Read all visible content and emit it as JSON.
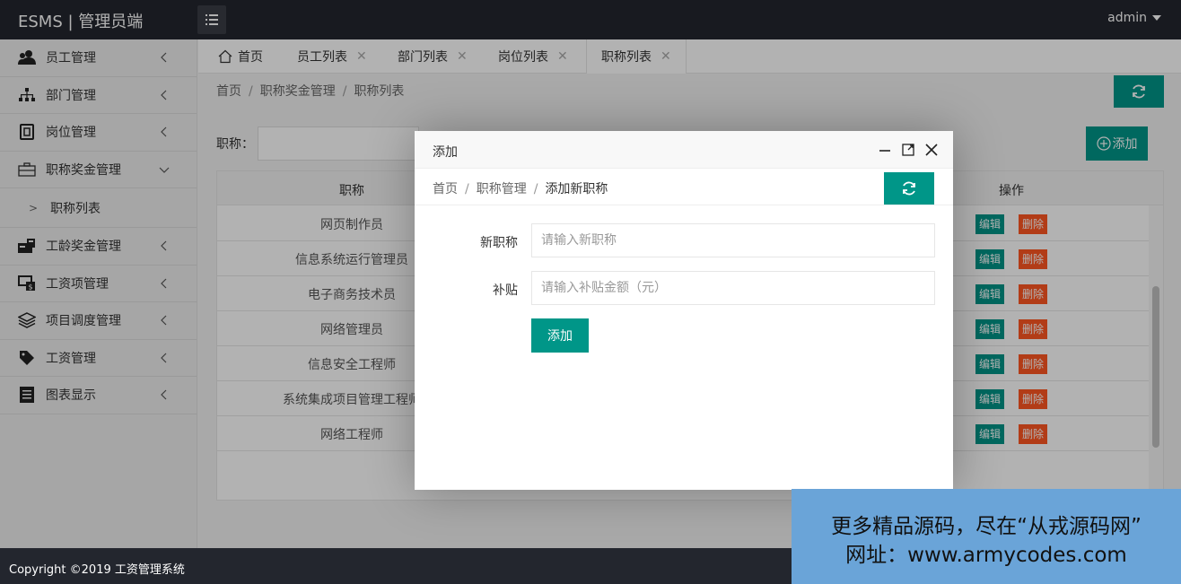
{
  "app": {
    "title": "ESMS | 管理员端",
    "user": "admin"
  },
  "sidebar": {
    "items": [
      {
        "label": "员工管理",
        "icon": "users-icon"
      },
      {
        "label": "部门管理",
        "icon": "sitemap-icon"
      },
      {
        "label": "岗位管理",
        "icon": "id-card-icon"
      },
      {
        "label": "职称奖金管理",
        "icon": "briefcase-icon",
        "expanded": true
      },
      {
        "label": "工龄奖金管理",
        "icon": "wallet-icon"
      },
      {
        "label": "工资项管理",
        "icon": "money-screen-icon"
      },
      {
        "label": "项目调度管理",
        "icon": "layers-icon"
      },
      {
        "label": "工资管理",
        "icon": "tag-icon"
      },
      {
        "label": "图表显示",
        "icon": "list-book-icon"
      }
    ],
    "sub_item": "职称列表"
  },
  "tabs": [
    {
      "label": "首页"
    },
    {
      "label": "员工列表"
    },
    {
      "label": "部门列表"
    },
    {
      "label": "岗位列表"
    },
    {
      "label": "职称列表",
      "active": true
    }
  ],
  "breadcrumb": [
    "首页",
    "职称奖金管理",
    "职称列表"
  ],
  "search": {
    "label": "职称："
  },
  "add_button": "添加",
  "table": {
    "headers": [
      "职称",
      "操作"
    ],
    "rows": [
      "网页制作员",
      "信息系统运行管理员",
      "电子商务技术员",
      "网络管理员",
      "信息安全工程师",
      "系统集成项目管理工程师",
      "网络工程师"
    ],
    "edit_label": "编辑",
    "delete_label": "删除"
  },
  "modal": {
    "title": "添加",
    "breadcrumb": [
      "首页",
      "职称管理",
      "添加新职称"
    ],
    "fields": [
      {
        "label": "新职称",
        "placeholder": "请输入新职称"
      },
      {
        "label": "补贴",
        "placeholder": "请输入补贴金额（元）"
      }
    ],
    "submit": "添加"
  },
  "footer": {
    "copyright": "Copyright ©2019 工资管理系统"
  },
  "watermark": {
    "line1": "更多精品源码，尽在“从戎源码网”",
    "line2": "网址：www.armycodes.com"
  },
  "colors": {
    "primary": "#009688",
    "danger": "#ff5722",
    "header": "#23262e"
  }
}
